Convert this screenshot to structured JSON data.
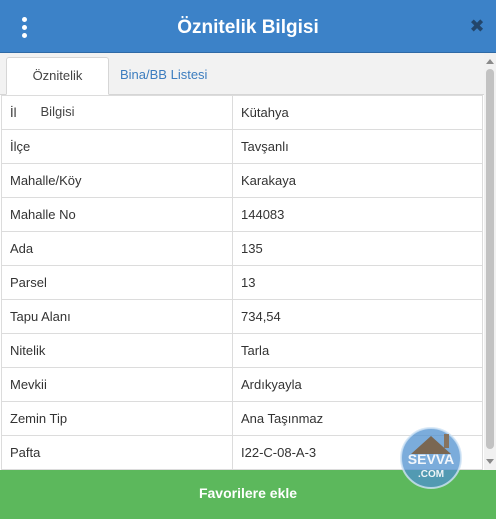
{
  "header": {
    "title": "Öznitelik Bilgisi",
    "menu_icon": "kebab-menu-icon",
    "close_icon": "close-icon",
    "close_symbol": "✖"
  },
  "tabs": [
    {
      "label": "Öznitelik Bilgisi",
      "active": true
    },
    {
      "label": "Bina/BB Listesi",
      "active": false
    }
  ],
  "attributes": [
    {
      "key": "İl",
      "value": "Kütahya"
    },
    {
      "key": "İlçe",
      "value": "Tavşanlı"
    },
    {
      "key": "Mahalle/Köy",
      "value": "Karakaya"
    },
    {
      "key": "Mahalle No",
      "value": "144083"
    },
    {
      "key": "Ada",
      "value": "135"
    },
    {
      "key": "Parsel",
      "value": "13"
    },
    {
      "key": "Tapu Alanı",
      "value": "734,54"
    },
    {
      "key": "Nitelik",
      "value": "Tarla"
    },
    {
      "key": "Mevkii",
      "value": "Ardıkyayla"
    },
    {
      "key": "Zemin Tip",
      "value": "Ana Taşınmaz"
    },
    {
      "key": "Pafta",
      "value": "I22-C-08-A-3"
    }
  ],
  "footer": {
    "button_label": "Favorilere ekle"
  },
  "watermark": {
    "text_top": "SEVVA",
    "text_bottom": ".COM"
  },
  "colors": {
    "header": "#3c82c8",
    "footer": "#5cb85c",
    "tab_link": "#3c7dbf"
  }
}
